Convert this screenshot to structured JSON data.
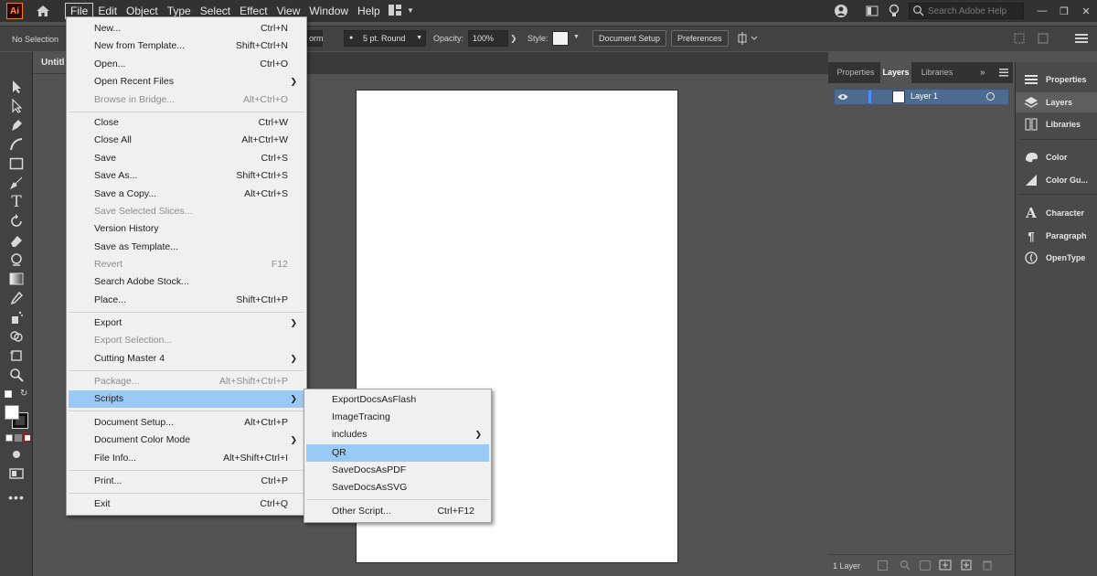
{
  "app": {
    "logo": "Ai",
    "menus": [
      "File",
      "Edit",
      "Object",
      "Type",
      "Select",
      "Effect",
      "View",
      "Window",
      "Help"
    ],
    "search_placeholder": "Search Adobe Help"
  },
  "controlbar": {
    "selection": "No Selection",
    "style_fragment": "orm",
    "stroke_profile": "5 pt. Round",
    "opacity_label": "Opacity:",
    "opacity_value": "100%",
    "style_label": "Style:",
    "document_setup": "Document Setup",
    "preferences": "Preferences"
  },
  "document": {
    "tab_title": "Untitl"
  },
  "file_menu": [
    {
      "label": "New...",
      "shortcut": "Ctrl+N"
    },
    {
      "label": "New from Template...",
      "shortcut": "Shift+Ctrl+N"
    },
    {
      "label": "Open...",
      "shortcut": "Ctrl+O"
    },
    {
      "label": "Open Recent Files",
      "shortcut": ""
    },
    {
      "label": "Browse in Bridge...",
      "shortcut": "Alt+Ctrl+O"
    },
    {
      "label": "Close",
      "shortcut": "Ctrl+W"
    },
    {
      "label": "Close All",
      "shortcut": "Alt+Ctrl+W"
    },
    {
      "label": "Save",
      "shortcut": "Ctrl+S"
    },
    {
      "label": "Save As...",
      "shortcut": "Shift+Ctrl+S"
    },
    {
      "label": "Save a Copy...",
      "shortcut": "Alt+Ctrl+S"
    },
    {
      "label": "Save Selected Slices...",
      "shortcut": ""
    },
    {
      "label": "Version History",
      "shortcut": ""
    },
    {
      "label": "Save as Template...",
      "shortcut": ""
    },
    {
      "label": "Revert",
      "shortcut": "F12"
    },
    {
      "label": "Search Adobe Stock...",
      "shortcut": ""
    },
    {
      "label": "Place...",
      "shortcut": "Shift+Ctrl+P"
    },
    {
      "label": "Export",
      "shortcut": ""
    },
    {
      "label": "Export Selection...",
      "shortcut": ""
    },
    {
      "label": "Cutting Master 4",
      "shortcut": ""
    },
    {
      "label": "Package...",
      "shortcut": "Alt+Shift+Ctrl+P"
    },
    {
      "label": "Scripts",
      "shortcut": ""
    },
    {
      "label": "Document Setup...",
      "shortcut": "Alt+Ctrl+P"
    },
    {
      "label": "Document Color Mode",
      "shortcut": ""
    },
    {
      "label": "File Info...",
      "shortcut": "Alt+Shift+Ctrl+I"
    },
    {
      "label": "Print...",
      "shortcut": "Ctrl+P"
    },
    {
      "label": "Exit",
      "shortcut": "Ctrl+Q"
    }
  ],
  "scripts_menu": [
    {
      "label": "ExportDocsAsFlash",
      "shortcut": ""
    },
    {
      "label": "ImageTracing",
      "shortcut": ""
    },
    {
      "label": "includes",
      "shortcut": ""
    },
    {
      "label": "QR",
      "shortcut": ""
    },
    {
      "label": "SaveDocsAsPDF",
      "shortcut": ""
    },
    {
      "label": "SaveDocsAsSVG",
      "shortcut": ""
    },
    {
      "label": "Other Script...",
      "shortcut": "Ctrl+F12"
    }
  ],
  "layers_panel": {
    "tabs": [
      "Properties",
      "Layers",
      "Libraries"
    ],
    "layer_name": "Layer 1",
    "footer_count": "1 Layer"
  },
  "dock": [
    "Properties",
    "Layers",
    "Libraries",
    "Color",
    "Color Gu...",
    "Character",
    "Paragraph",
    "OpenType"
  ],
  "colors": {
    "menu_highlight": "#99c9f5",
    "menu_bg": "#f0f0f0",
    "ui_dark": "#323232",
    "ui_panel": "#424242",
    "canvas": "#535353",
    "layer_selected": "#4d6a8f"
  }
}
